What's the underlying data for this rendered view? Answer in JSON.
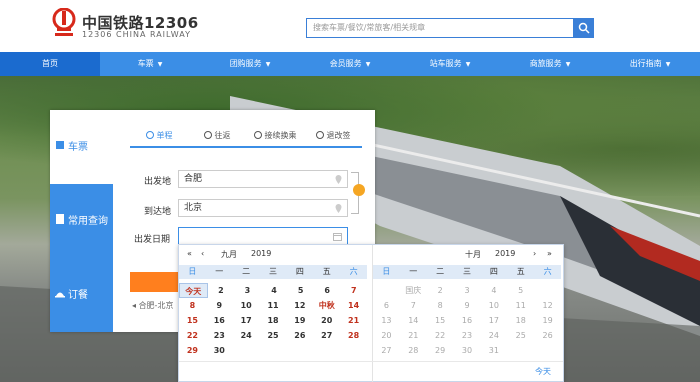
{
  "brand": {
    "name_cn": "中国铁路12306",
    "name_en": "12306 CHINA RAILWAY",
    "accent": "#3b8ee6",
    "logo_color": "#d7291b"
  },
  "search": {
    "placeholder": "搜索车票/餐饮/常旅客/相关规章"
  },
  "nav": [
    {
      "label": "首页",
      "caret": false
    },
    {
      "label": "车票",
      "caret": true
    },
    {
      "label": "团购服务",
      "caret": true
    },
    {
      "label": "会员服务",
      "caret": true
    },
    {
      "label": "站车服务",
      "caret": true
    },
    {
      "label": "商旅服务",
      "caret": true
    },
    {
      "label": "出行指南",
      "caret": true
    }
  ],
  "side": [
    {
      "label": "车票",
      "icon": "ticket-icon"
    },
    {
      "label": "常用查询",
      "icon": "document-icon"
    },
    {
      "label": "订餐",
      "icon": "dining-icon"
    }
  ],
  "trip_tabs": [
    "单程",
    "往返",
    "接续换乘",
    "退改签"
  ],
  "form": {
    "from_label": "出发地",
    "from_value": "合肥",
    "to_label": "到达地",
    "to_value": "北京",
    "date_label": "出发日期",
    "history": "合肥-北京"
  },
  "calendar": {
    "left": {
      "month": "九月",
      "year": "2019"
    },
    "right": {
      "month": "十月",
      "year": "2019"
    },
    "weekdays": [
      "日",
      "一",
      "二",
      "三",
      "四",
      "五",
      "六"
    ],
    "left_rows": [
      [
        "今天",
        "2",
        "3",
        "4",
        "5",
        "6",
        "7"
      ],
      [
        "8",
        "9",
        "10",
        "11",
        "12",
        "中秋",
        "14"
      ],
      [
        "15",
        "16",
        "17",
        "18",
        "19",
        "20",
        "21"
      ],
      [
        "22",
        "23",
        "24",
        "25",
        "26",
        "27",
        "28"
      ],
      [
        "29",
        "30",
        "",
        "",
        "",
        "",
        ""
      ]
    ],
    "right_rows": [
      [
        "",
        "国庆",
        "2",
        "3",
        "4",
        "5",
        ""
      ],
      [
        "6",
        "7",
        "8",
        "9",
        "10",
        "11",
        "12"
      ],
      [
        "13",
        "14",
        "15",
        "16",
        "17",
        "18",
        "19"
      ],
      [
        "20",
        "21",
        "22",
        "23",
        "24",
        "25",
        "26"
      ],
      [
        "27",
        "28",
        "29",
        "30",
        "31",
        "",
        ""
      ]
    ],
    "footer": "今天"
  }
}
